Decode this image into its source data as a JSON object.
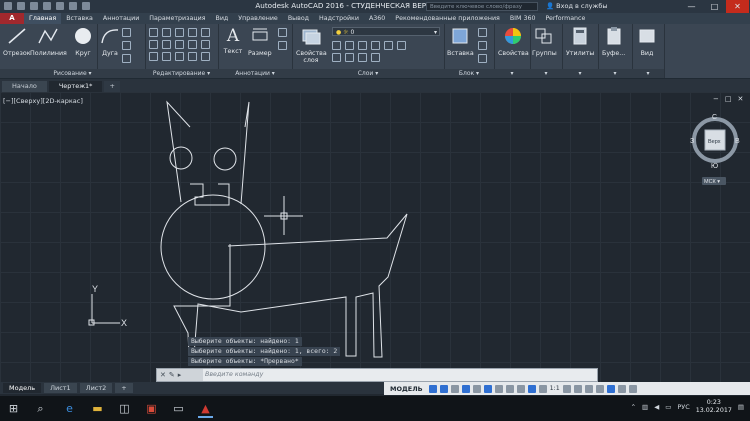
{
  "window": {
    "title": "Autodesk AutoCAD 2016 - СТУДЕНЧЕСКАЯ ВЕРСИЯ   Чертеж1.dwg",
    "search_placeholder": "Введите ключевое слово/фразу",
    "signin": "Вход в службы",
    "minimize": "—",
    "maximize": "□",
    "close": "✕"
  },
  "app_button": "A",
  "ribbon_tabs": [
    "Главная",
    "Вставка",
    "Аннотации",
    "Параметризация",
    "Вид",
    "Управление",
    "Вывод",
    "Надстройки",
    "A360",
    "Рекомендованные приложения",
    "BIM 360",
    "Performance"
  ],
  "ribbon": {
    "draw": {
      "title": "Рисование ▾",
      "line": "Отрезок",
      "polyline": "Полилиния",
      "circle": "Круг",
      "arc": "Дуга"
    },
    "modify": {
      "title": "Редактирование ▾"
    },
    "annotation": {
      "title": "Аннотации ▾",
      "text": "Текст",
      "dimension": "Размер"
    },
    "layers": {
      "title": "Слои ▾",
      "properties": "Свойства слоя",
      "current": "0"
    },
    "block": {
      "title": "Блок ▾",
      "insert": "Вставка"
    },
    "properties": {
      "label": "Свойства"
    },
    "groups": {
      "label": "Группы"
    },
    "utilities": {
      "label": "Утилиты"
    },
    "clipboard": {
      "label": "Буфе..."
    },
    "view": {
      "label": "Вид"
    }
  },
  "doc_tabs": [
    "Начало",
    "Чертеж1*",
    "+"
  ],
  "viewport": {
    "label": "[−][Сверху][2D-каркас]",
    "controls": [
      "−",
      "□",
      "✕"
    ],
    "viewcube": {
      "north": "С",
      "south": "Ю",
      "west": "З",
      "east": "В",
      "top": "Верх",
      "wcs": "МСК ▾"
    },
    "ucs_x": "X",
    "ucs_y": "Y"
  },
  "command_history": [
    "Выберите объекты: найдено: 1",
    "Выберите объекты: найдено: 1, всего: 2",
    "Выберите объекты: *Прервано*"
  ],
  "command_input": {
    "placeholder": "Введите команду"
  },
  "layout_tabs": [
    "Модель",
    "Лист1",
    "Лист2",
    "+"
  ],
  "statusbar": {
    "model": "МОДЕЛЬ",
    "scale": "1:1"
  },
  "taskbar": {
    "language": "РУС",
    "time": "0:23",
    "date": "13.02.2017"
  },
  "colors": {
    "canvas": "#212830",
    "drawing_lines": "#dfe3e8",
    "app_button": "#a1282d",
    "statusbar_accent": "#2f6fd1"
  }
}
